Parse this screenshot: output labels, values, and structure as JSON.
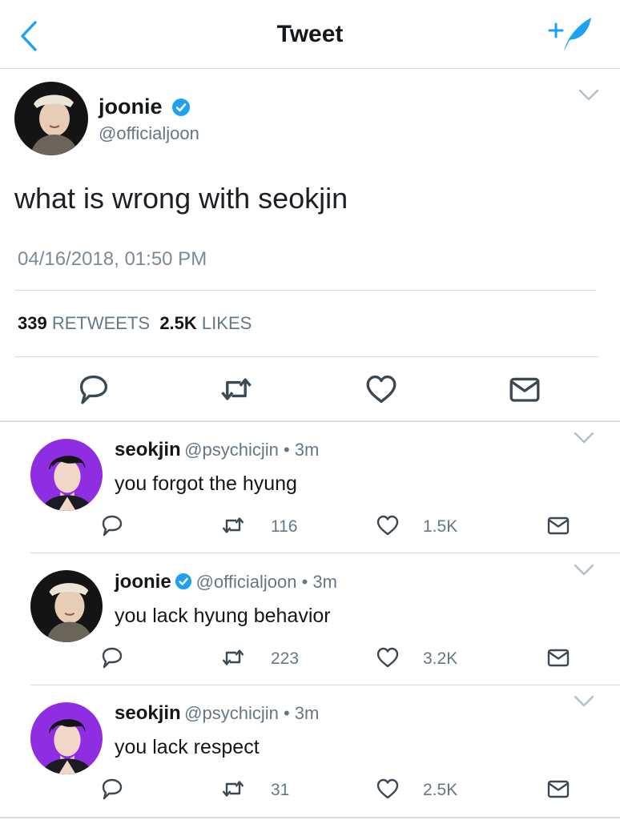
{
  "header": {
    "title": "Tweet",
    "back_icon": "chevron-left-icon",
    "compose_icon": "compose-feather-icon"
  },
  "colors": {
    "accent": "#1da1f2",
    "secondary_text": "#657786",
    "divider": "#d8dde2",
    "avatar_purple": "#8e2de2"
  },
  "tweet": {
    "name": "joonie",
    "handle": "@officialjoon",
    "text": "what is wrong with seokjin",
    "timestamp": "04/16/2018, 01:50 PM",
    "retweets_count": "339",
    "retweets_label": "RETWEETS",
    "likes_count": "2.5K",
    "likes_label": "LIKES"
  },
  "replies": [
    {
      "name": "seokjin",
      "meta": "@psychicjin • 3m",
      "text": "you forgot the hyung",
      "retweets": "116",
      "likes": "1.5K"
    },
    {
      "name": "joonie",
      "meta": "@officialjoon • 3m",
      "text": "you lack hyung behavior",
      "retweets": "223",
      "likes": "3.2K"
    },
    {
      "name": "seokjin",
      "meta": "@psychicjin • 3m",
      "text": "you lack respect",
      "retweets": "31",
      "likes": "2.5K"
    }
  ]
}
